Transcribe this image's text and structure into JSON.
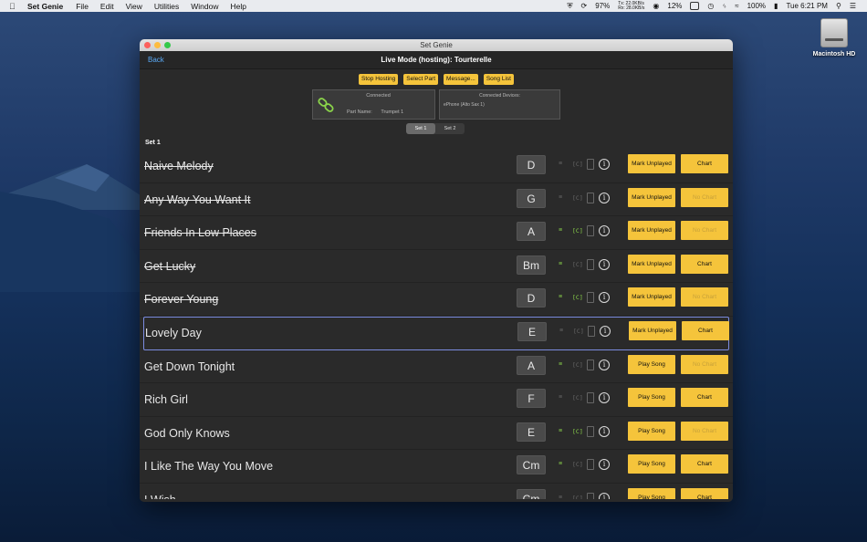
{
  "menubar": {
    "app_name": "Set Genie",
    "menus": [
      "File",
      "Edit",
      "View",
      "Utilities",
      "Window",
      "Help"
    ],
    "net_tx": "Tx:  22.0KB/s",
    "net_rx": "Rx:  28.0KB/s",
    "battery_cpu": "97%",
    "cpu2": "12%",
    "battery": "100%",
    "clock": "Tue 6:21 PM"
  },
  "desktop": {
    "disk_label": "Macintosh HD"
  },
  "window": {
    "title": "Set Genie",
    "back_label": "Back",
    "nav_title": "Live Mode (hosting): Tourterelle"
  },
  "toolbar": {
    "stop_hosting": "Stop Hosting",
    "select_part": "Select Part",
    "message": "Message...",
    "song_list": "Song List"
  },
  "status_panel": {
    "status": "Connected",
    "part_label": "Part Name:",
    "part_value": "Trumpet 1"
  },
  "devices_panel": {
    "title": "Connected Devices:",
    "device": "ePhone (Alto Sax 1)"
  },
  "sets": {
    "tabs": [
      "Set 1",
      "Set 2"
    ],
    "selected": "Set 1",
    "header": "Set 1"
  },
  "colors": {
    "accent_yellow": "#f5c43b",
    "icon_on_green": "#8ad34a",
    "link_blue": "#5aa9f5",
    "selection_border": "#7b8cdf"
  },
  "songs": [
    {
      "title": "Naive Melody",
      "key": "D",
      "played": true,
      "lyrics": false,
      "chords": false,
      "primary": "Mark Unplayed",
      "chart": "Chart",
      "chart_enabled": true
    },
    {
      "title": "Any Way You Want It",
      "key": "G",
      "played": true,
      "lyrics": false,
      "chords": false,
      "primary": "Mark Unplayed",
      "chart": "No Chart",
      "chart_enabled": false
    },
    {
      "title": "Friends In Low Places",
      "key": "A",
      "played": true,
      "lyrics": true,
      "chords": true,
      "primary": "Mark Unplayed",
      "chart": "No Chart",
      "chart_enabled": false
    },
    {
      "title": "Get Lucky",
      "key": "Bm",
      "played": true,
      "lyrics": true,
      "chords": false,
      "primary": "Mark Unplayed",
      "chart": "Chart",
      "chart_enabled": true
    },
    {
      "title": "Forever Young",
      "key": "D",
      "played": true,
      "lyrics": true,
      "chords": true,
      "primary": "Mark Unplayed",
      "chart": "No Chart",
      "chart_enabled": false
    },
    {
      "title": "Lovely Day",
      "key": "E",
      "played": false,
      "lyrics": false,
      "chords": false,
      "primary": "Mark Unplayed",
      "chart": "Chart",
      "chart_enabled": true,
      "selected": true
    },
    {
      "title": "Get Down Tonight",
      "key": "A",
      "played": false,
      "lyrics": true,
      "chords": false,
      "primary": "Play Song",
      "chart": "No Chart",
      "chart_enabled": false
    },
    {
      "title": "Rich Girl",
      "key": "F",
      "played": false,
      "lyrics": false,
      "chords": false,
      "primary": "Play Song",
      "chart": "Chart",
      "chart_enabled": true
    },
    {
      "title": "God Only Knows",
      "key": "E",
      "played": false,
      "lyrics": true,
      "chords": true,
      "primary": "Play Song",
      "chart": "No Chart",
      "chart_enabled": false
    },
    {
      "title": "I Like The Way You Move",
      "key": "Cm",
      "played": false,
      "lyrics": true,
      "chords": false,
      "primary": "Play Song",
      "chart": "Chart",
      "chart_enabled": true
    },
    {
      "title": "I Wish",
      "key": "Cm",
      "played": false,
      "lyrics": false,
      "chords": false,
      "primary": "Play Song",
      "chart": "Chart",
      "chart_enabled": true
    }
  ]
}
